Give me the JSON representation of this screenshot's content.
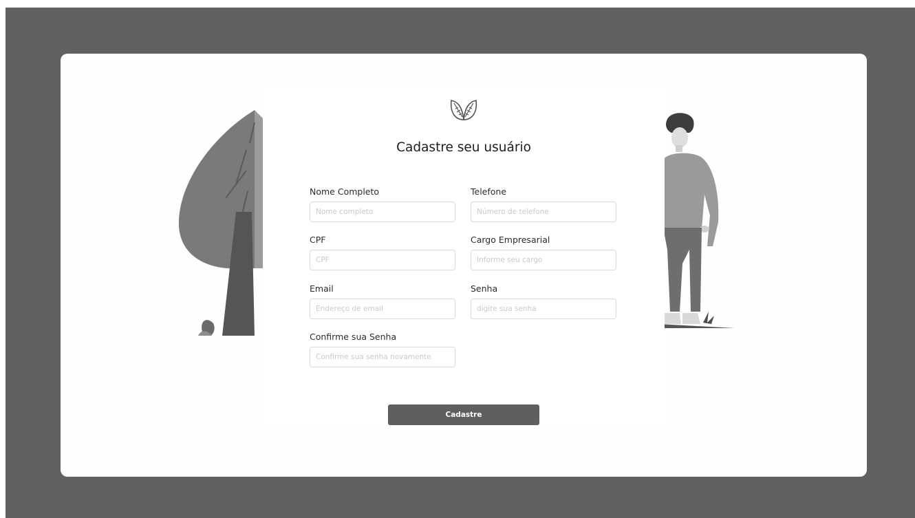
{
  "form": {
    "title": "Cadastre seu usuário",
    "fields": {
      "nome": {
        "label": "Nome Completo",
        "placeholder": "Nome completo"
      },
      "telefone": {
        "label": "Telefone",
        "placeholder": "Número de telefone"
      },
      "cpf": {
        "label": "CPF",
        "placeholder": "CPF"
      },
      "cargo": {
        "label": "Cargo Empresarial",
        "placeholder": "Informe seu cargo"
      },
      "email": {
        "label": "Email",
        "placeholder": "Endereço de email"
      },
      "senha": {
        "label": "Senha",
        "placeholder": "digite sua senha"
      },
      "confirmar": {
        "label": "Confirme sua Senha",
        "placeholder": "Confirme sua senha novamente"
      }
    },
    "submit_label": "Cadastre"
  },
  "icons": {
    "logo": "leaves-logo-icon",
    "left_illustration": "tree-illustration",
    "right_illustration": "person-illustration"
  },
  "colors": {
    "backdrop": "#616161",
    "card": "#fefefe",
    "button": "#5f5f5f",
    "input_border": "#dadada",
    "placeholder": "#c9c9c9"
  }
}
